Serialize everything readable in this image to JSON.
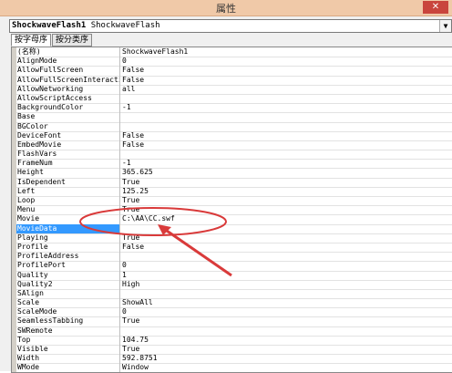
{
  "window": {
    "title": "属性",
    "close_label": "✕"
  },
  "object_selector": {
    "name": "ShockwaveFlash1",
    "type": "ShockwaveFlash"
  },
  "tabs": [
    {
      "label": "按字母序"
    },
    {
      "label": "按分类序"
    }
  ],
  "properties": [
    {
      "name": "(名称)",
      "value": "ShockwaveFlash1"
    },
    {
      "name": "AlignMode",
      "value": "0"
    },
    {
      "name": "AllowFullScreen",
      "value": "False"
    },
    {
      "name": "AllowFullScreenInteractive",
      "value": "False"
    },
    {
      "name": "AllowNetworking",
      "value": "all"
    },
    {
      "name": "AllowScriptAccess",
      "value": ""
    },
    {
      "name": "BackgroundColor",
      "value": "-1"
    },
    {
      "name": "Base",
      "value": ""
    },
    {
      "name": "BGColor",
      "value": ""
    },
    {
      "name": "DeviceFont",
      "value": "False"
    },
    {
      "name": "EmbedMovie",
      "value": "False"
    },
    {
      "name": "FlashVars",
      "value": ""
    },
    {
      "name": "FrameNum",
      "value": "-1"
    },
    {
      "name": "Height",
      "value": "365.625"
    },
    {
      "name": "IsDependent",
      "value": "True"
    },
    {
      "name": "Left",
      "value": "125.25"
    },
    {
      "name": "Loop",
      "value": "True"
    },
    {
      "name": "Menu",
      "value": "True"
    },
    {
      "name": "Movie",
      "value": "C:\\AA\\CC.swf"
    },
    {
      "name": "MovieData",
      "value": ""
    },
    {
      "name": "Playing",
      "value": "True"
    },
    {
      "name": "Profile",
      "value": "False"
    },
    {
      "name": "ProfileAddress",
      "value": ""
    },
    {
      "name": "ProfilePort",
      "value": "0"
    },
    {
      "name": "Quality",
      "value": "1"
    },
    {
      "name": "Quality2",
      "value": "High"
    },
    {
      "name": "SAlign",
      "value": ""
    },
    {
      "name": "Scale",
      "value": "ShowAll"
    },
    {
      "name": "ScaleMode",
      "value": "0"
    },
    {
      "name": "SeamlessTabbing",
      "value": "True"
    },
    {
      "name": "SWRemote",
      "value": ""
    },
    {
      "name": "Top",
      "value": "104.75"
    },
    {
      "name": "Visible",
      "value": "True"
    },
    {
      "name": "Width",
      "value": "592.8751"
    },
    {
      "name": "WMode",
      "value": "Window"
    }
  ],
  "selected_index": 19,
  "colors": {
    "annotation": "#d93a3a",
    "selection": "#3399ff",
    "titlebar": "#f0c9a8"
  }
}
